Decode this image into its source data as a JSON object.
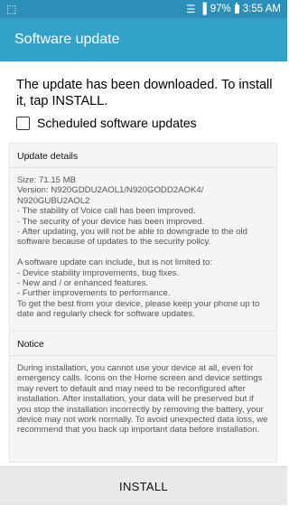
{
  "status_bar": {
    "battery": "97%",
    "time": "3:55 AM"
  },
  "app_bar": {
    "title": "Software update"
  },
  "headline": "The update has been downloaded. To install it, tap INSTALL.",
  "scheduled": {
    "label": "Scheduled software updates",
    "checked": false
  },
  "update_details": {
    "heading": "Update details",
    "body": "Size: 71.15 MB\nVersion: N920GDDU2AOL1/N920GODD2AOK4/\nN920GUBU2AOL2\n· The stability of Voice call has been improved.\n· The security of your device has been improved.\n· After updating, you will not be able to downgrade to the old software because of updates to the security policy.\n\nA software update can include, but is not limited to:\n- Device stability improvements, bug fixes.\n- New and / or enhanced features.\n- Further improvements to performance.\nTo get the best from your device, please keep your phone up to date and regularly check for software updates."
  },
  "notice": {
    "heading": "Notice",
    "body": "During installation, you cannot use your device at all, even for emergency calls. Icons on the Home screen and device settings may revert to default and may need to be reconfigured after installation. After installation, your data will be preserved but if you stop the installation incorrectly by removing the battery, your device may not work normally. To avoid unexpected data loss, we recommend that you back up important data before installation."
  },
  "install_button": "INSTALL",
  "icons": {
    "status_left": "screen-cast-icon",
    "wifi": "wifi-icon",
    "signal": "signal-icon",
    "battery": "battery-icon"
  },
  "colors": {
    "status_bar": "#2c8fb8",
    "app_bar": "#33a2c8"
  }
}
